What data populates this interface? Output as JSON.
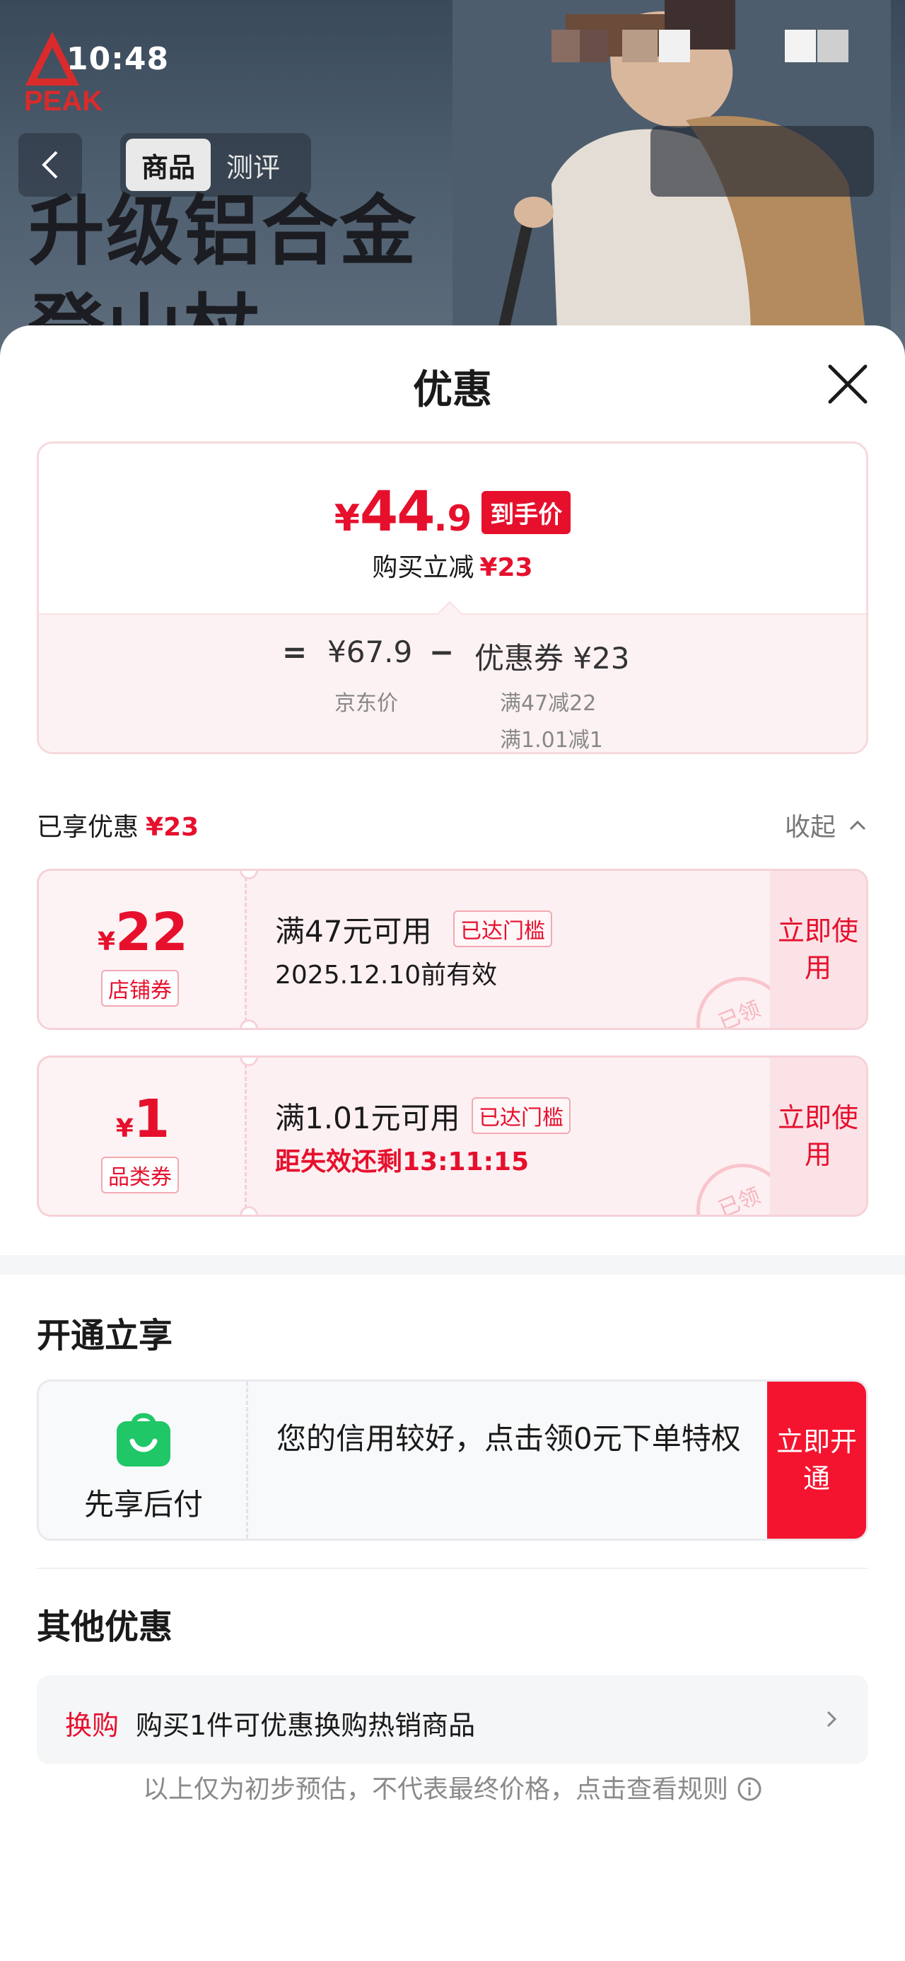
{
  "status_bar": {
    "time": "10:48"
  },
  "header": {
    "brand": "PEAK",
    "tabs": [
      {
        "label": "商品"
      },
      {
        "label": "测评"
      }
    ],
    "banner_text_line1": "升级铝合金",
    "banner_text_line2": "登山杖"
  },
  "sheet": {
    "title": "优惠",
    "summary": {
      "price_yen": "¥",
      "price_int": "44",
      "price_dec": ".9",
      "price_tag": "到手价",
      "reduce_label": "购买立减",
      "reduce_value": "¥23",
      "eq": "=",
      "jd_price": "¥67.9",
      "minus": "−",
      "coupon_total": "优惠券 ¥23",
      "jd_label": "京东价",
      "coupon_rule_1": "满47减22",
      "coupon_rule_2": "满1.01减1"
    },
    "enjoyed_label": "已享优惠",
    "enjoyed_value": "¥23",
    "collapse_label": "收起",
    "coupons": [
      {
        "yen": "¥",
        "amount": "22",
        "type": "店铺券",
        "condition": "满47元可用",
        "reached": "已达门槛",
        "validity": "2025.12.10前有效",
        "stamp": "已领",
        "button": "立即使用"
      },
      {
        "yen": "¥",
        "amount": "1",
        "type": "品类券",
        "condition": "满1.01元可用",
        "reached": "已达门槛",
        "validity": "距失效还剩13:11:15",
        "stamp": "已领",
        "button": "立即使用"
      }
    ],
    "open_section": {
      "title": "开通立享",
      "service": "先享后付",
      "description": "您的信用较好，点击领0元下单特权",
      "button": "立即开通",
      "icon": "shopping-bag-icon",
      "icon_color": "#1fc766"
    },
    "other_section": {
      "title": "其他优惠",
      "tag": "换购",
      "text": "购买1件可优惠换购热销商品"
    },
    "footer_note": "以上仅为初步预估，不代表最终价格，点击查看规则"
  },
  "colors": {
    "accent_red": "#e6102d",
    "button_red": "#f5142f"
  }
}
